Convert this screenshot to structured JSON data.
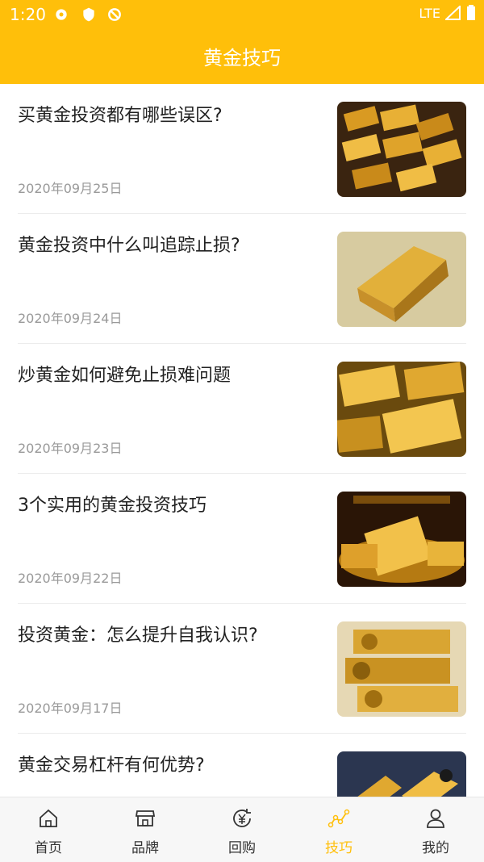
{
  "status": {
    "time": "1:20",
    "network": "LTE"
  },
  "header": {
    "title": "黄金技巧"
  },
  "articles": [
    {
      "title": "买黄金投资都有哪些误区?",
      "date": "2020年09月25日"
    },
    {
      "title": "黄金投资中什么叫追踪止损?",
      "date": "2020年09月24日"
    },
    {
      "title": "炒黄金如何避免止损难问题",
      "date": "2020年09月23日"
    },
    {
      "title": "3个实用的黄金投资技巧",
      "date": "2020年09月22日"
    },
    {
      "title": "投资黄金：怎么提升自我认识?",
      "date": "2020年09月17日"
    },
    {
      "title": "黄金交易杠杆有何优势?",
      "date": ""
    }
  ],
  "tabs": [
    {
      "label": "首页",
      "icon": "home-icon"
    },
    {
      "label": "品牌",
      "icon": "store-icon"
    },
    {
      "label": "回购",
      "icon": "yen-cycle-icon"
    },
    {
      "label": "技巧",
      "icon": "chart-line-icon"
    },
    {
      "label": "我的",
      "icon": "user-icon"
    }
  ],
  "colors": {
    "accent": "#FFBF0A",
    "title": "#222222",
    "date": "#999999"
  }
}
